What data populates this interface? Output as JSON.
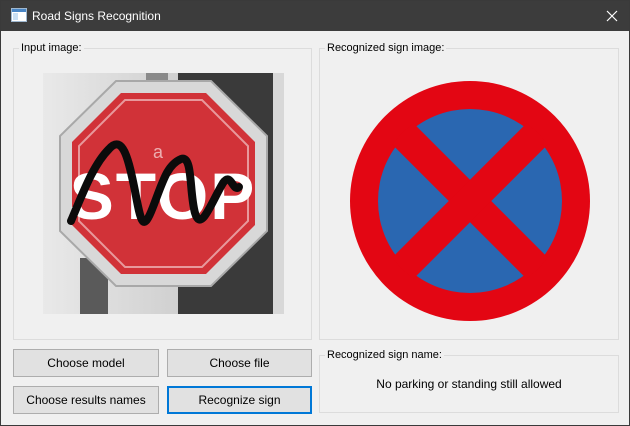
{
  "window": {
    "title": "Road Signs Recognition",
    "icon": "app-window-icon",
    "close_icon": "close-icon"
  },
  "input_group": {
    "title": "Input image:",
    "image_text": "STOP",
    "image_watermark": "a"
  },
  "recognized_image_group": {
    "title": "Recognized sign image:"
  },
  "recognized_name_group": {
    "title": "Recognized sign name:",
    "value": "No parking or standing still allowed"
  },
  "buttons": {
    "choose_model": "Choose model",
    "choose_file": "Choose file",
    "choose_results_names": "Choose results names",
    "recognize_sign": "Recognize sign"
  },
  "colors": {
    "title_bar": "#3c3c3c",
    "sign_red": "#e30613",
    "sign_blue": "#2a67b1",
    "focus_accent": "#0078d7"
  }
}
